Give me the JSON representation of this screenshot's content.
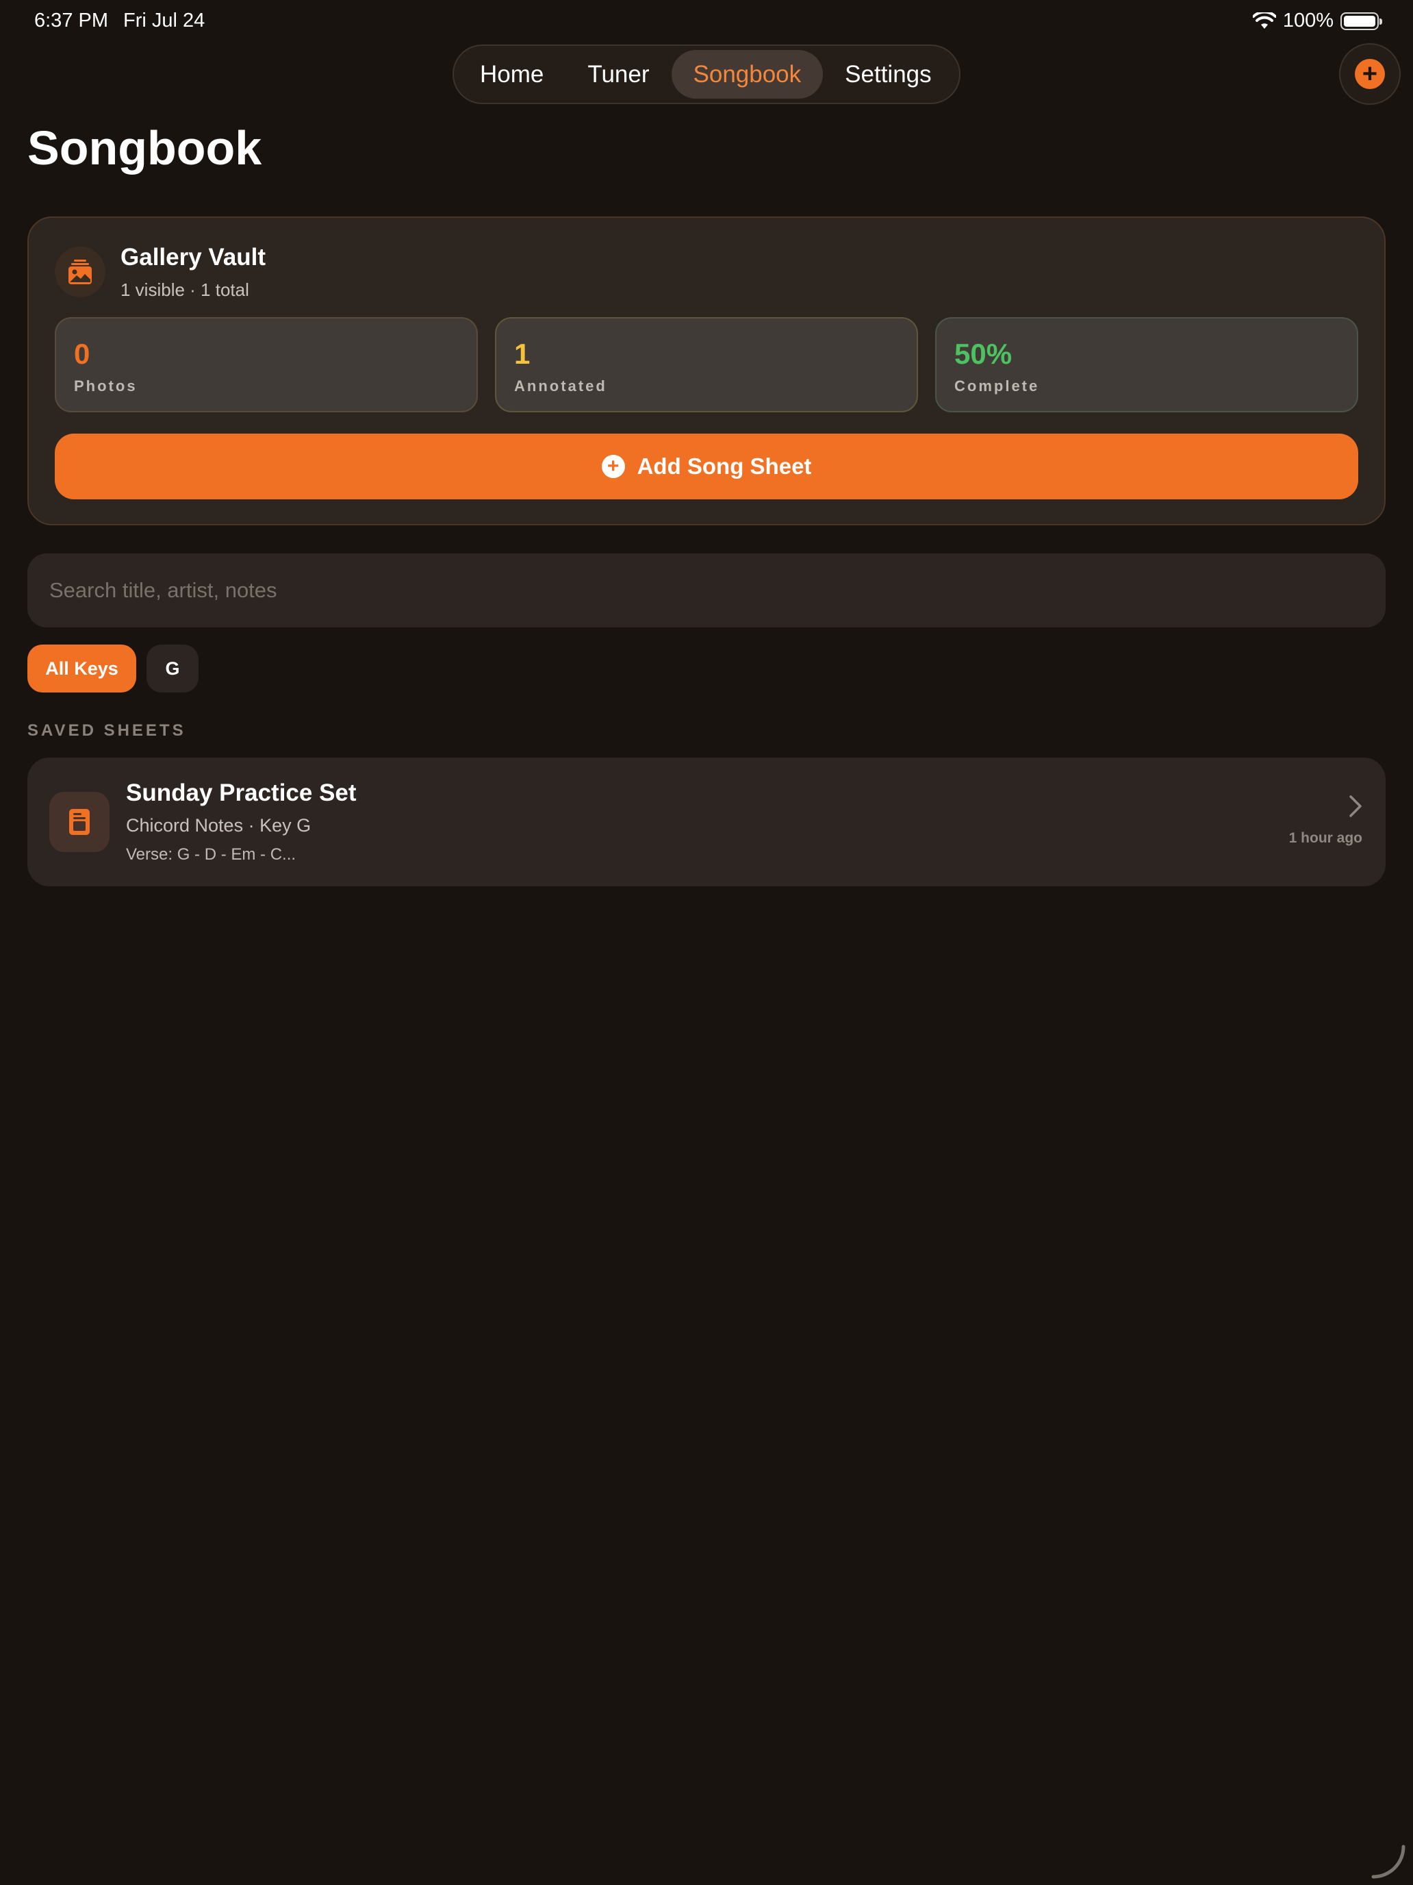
{
  "status_bar": {
    "time": "6:37 PM",
    "date": "Fri Jul 24",
    "battery": "100%"
  },
  "nav": {
    "tabs": [
      {
        "label": "Home",
        "active": false
      },
      {
        "label": "Tuner",
        "active": false
      },
      {
        "label": "Songbook",
        "active": true
      },
      {
        "label": "Settings",
        "active": false
      }
    ],
    "add_icon": "plus-circle-icon"
  },
  "page": {
    "title": "Songbook"
  },
  "vault": {
    "title": "Gallery Vault",
    "subtitle": "1 visible · 1 total",
    "icon": "gallery-icon",
    "stats": [
      {
        "value": "0",
        "label": "Photos",
        "color": "#f07123"
      },
      {
        "value": "1",
        "label": "Annotated",
        "color": "#f5c33b"
      },
      {
        "value": "50%",
        "label": "Complete",
        "color": "#4cc261"
      }
    ],
    "add_button_label": "Add Song Sheet"
  },
  "search": {
    "placeholder": "Search title, artist, notes",
    "value": ""
  },
  "filters": {
    "chips": [
      {
        "label": "All Keys",
        "selected": true
      },
      {
        "label": "G",
        "selected": false
      }
    ]
  },
  "sheets": {
    "section_label": "SAVED SHEETS",
    "items": [
      {
        "title": "Sunday Practice Set",
        "meta": "Chicord Notes · Key G",
        "preview": "Verse: G - D - Em - C...",
        "time": "1 hour ago",
        "icon": "document-icon"
      }
    ]
  },
  "colors": {
    "accent": "#f07123",
    "background": "#18130f",
    "card": "#2d2521"
  }
}
